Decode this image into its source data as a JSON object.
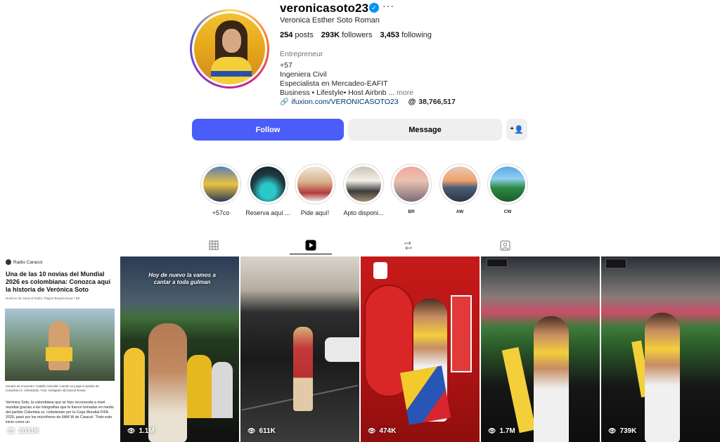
{
  "profile": {
    "username": "veronicasoto23",
    "full_name": "Veronica Esther Soto Roman",
    "stats": {
      "posts": "254",
      "posts_label": "posts",
      "followers": "293K",
      "followers_label": "followers",
      "following": "3,453",
      "following_label": "following"
    },
    "category": "Entrepreneur",
    "bio_lines": [
      "+57",
      "Ingeniera Civil",
      "Especialista en Mercadeo-EAFIT",
      "Business • Lifestyle• Host Airbnb ..."
    ],
    "bio_more": "more",
    "link": "ifuxion.com/VERONICASOTO23",
    "threads_count": "38,766,517"
  },
  "buttons": {
    "follow": "Follow",
    "message": "Message"
  },
  "highlights": [
    {
      "label": "+57co"
    },
    {
      "label": "Reserva aquí ..."
    },
    {
      "label": "Pide aquí!"
    },
    {
      "label": "Apto disponi..."
    },
    {
      "label": "BR"
    },
    {
      "label": "AW"
    },
    {
      "label": "CW"
    }
  ],
  "tabs": [
    {
      "icon": "grid-icon"
    },
    {
      "icon": "reels-icon"
    },
    {
      "icon": "repost-icon"
    },
    {
      "icon": "tagged-icon"
    }
  ],
  "reels": [
    {
      "views": "2031K",
      "brand": "Radio Caracol",
      "headline": "Una de las 10 novias del Mundial 2026 es colombiana: Conozca aquí la historia de Verónica Soto",
      "byline": "Noticias de Caracol Radio, Página Bogotá Boya • BE",
      "photo_caption": "Usuario de encuentro 'Cabello Atrevida' cuando se juega el partido de Colombia vs. Uzbekistán. Foto: Instagram @Caracol Rosas",
      "body": "Verónica Soto, la colombiana que se hizo reconocida a nivel mundial gracias a las fotografías que le fueron tomadas en medio del partido Colombia vs. Uzbekistán por la Copa Mundial FIFA 2026, pasó por los micrófonos de 6AM W de Caracol. 'Todo esto inicio como un"
    },
    {
      "views": "1.1M",
      "overlay": "Hoy de nuevo la vamos a cantar a toda gulman"
    },
    {
      "views": "611K"
    },
    {
      "views": "474K"
    },
    {
      "views": "1.7M"
    },
    {
      "views": "739K"
    }
  ]
}
